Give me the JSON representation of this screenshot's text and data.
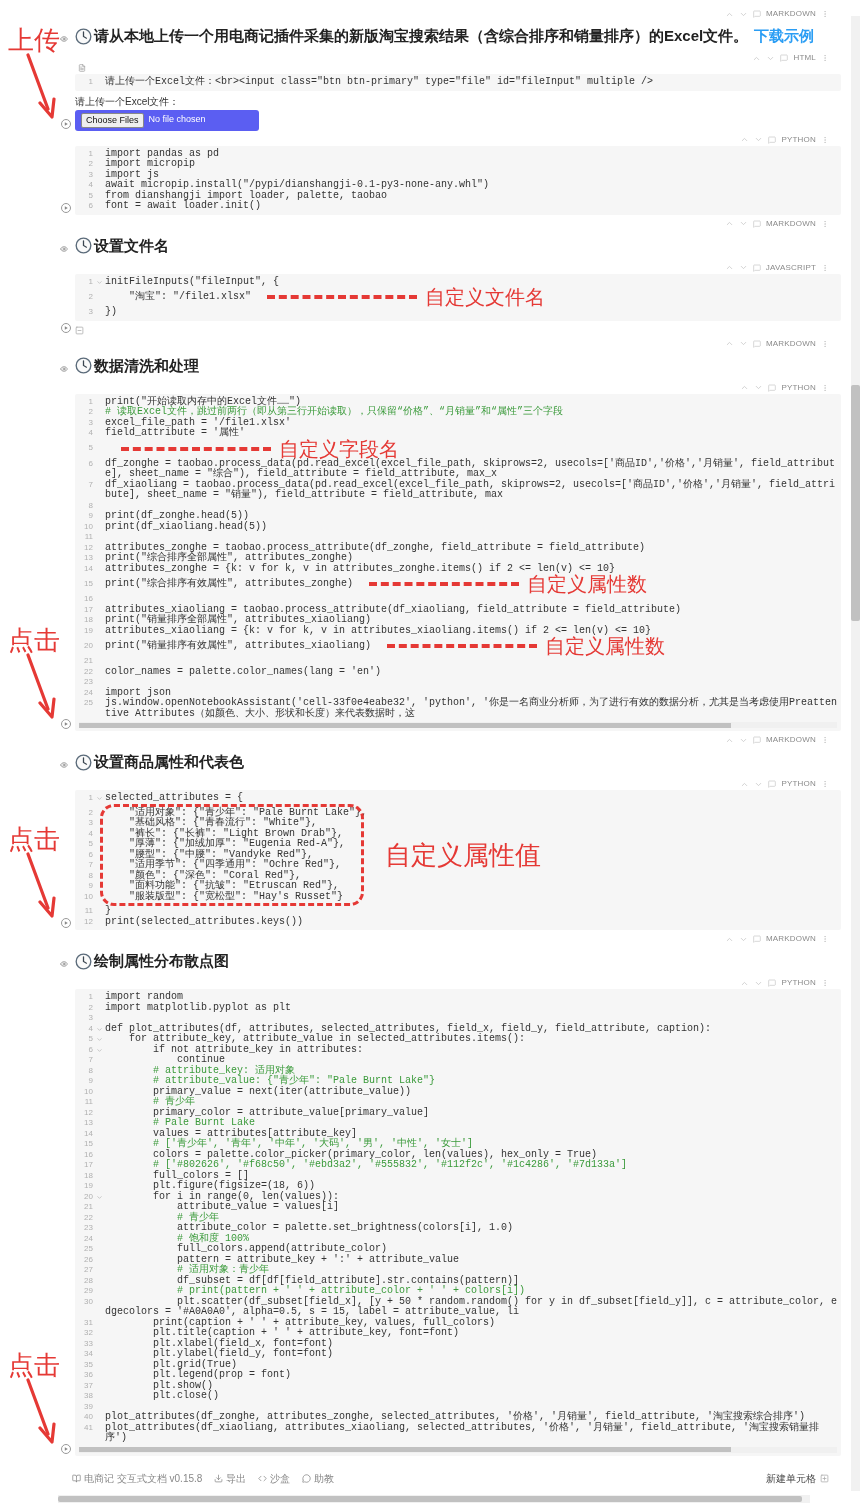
{
  "cells": [
    {
      "kind": "markdown",
      "lang": "MARKDOWN",
      "heading": "请从本地上传一个用电商记插件采集的新版淘宝搜索结果（含综合排序和销量排序）的Excel文件。",
      "link": "下载示例"
    },
    {
      "kind": "html",
      "lang": "HTML",
      "callout": "上传",
      "lines": [
        {
          "n": "1",
          "code": "请上传一个Excel文件：<br><input class=\"btn btn-primary\" type=\"file\" id=\"fileInput\" multiple />"
        }
      ],
      "output": {
        "label": "请上传一个Excel文件：",
        "button": "Choose Files",
        "status": "No file chosen"
      }
    },
    {
      "kind": "code",
      "lang": "PYTHON",
      "lines": [
        {
          "n": "1",
          "code": "import pandas as pd"
        },
        {
          "n": "2",
          "code": "import micropip"
        },
        {
          "n": "3",
          "code": "import js"
        },
        {
          "n": "4",
          "code": "await micropip.install(\"/pypi/dianshangji-0.1-py3-none-any.whl\")"
        },
        {
          "n": "5",
          "code": "from dianshangji import loader, palette, taobao"
        },
        {
          "n": "6",
          "code": "font = await loader.init()"
        }
      ]
    },
    {
      "kind": "markdown",
      "lang": "MARKDOWN",
      "heading": "设置文件名"
    },
    {
      "kind": "code",
      "lang": "JAVASCRIPT",
      "has_output": true,
      "lines": [
        {
          "n": "1",
          "fold": true,
          "code": "initFileInputs(\"fileInput\", {"
        },
        {
          "n": "2",
          "code": "    \"淘宝\": \"/file1.xlsx\"",
          "note": "自定义文件名"
        },
        {
          "n": "3",
          "code": "})"
        }
      ]
    },
    {
      "kind": "markdown",
      "lang": "MARKDOWN",
      "heading": "数据清洗和处理"
    },
    {
      "kind": "code",
      "lang": "PYTHON",
      "scrollable": true,
      "callout": "点击",
      "lines": [
        {
          "n": "1",
          "code": "print(\"开始读取内存中的Excel文件……\")"
        },
        {
          "n": "2",
          "kind": "comment",
          "code": "# 读取Excel文件，跳过前两行（即从第三行开始读取），只保留“价格”、“月销量”和“属性”三个字段"
        },
        {
          "n": "3",
          "code": "excel_file_path = '/file1.xlsx'"
        },
        {
          "n": "4",
          "code": "field_attribute = '属性'"
        },
        {
          "n": "5",
          "note": "自定义字段名"
        },
        {
          "n": "6",
          "code": "df_zonghe = taobao.process_data(pd.read_excel(excel_file_path, skiprows=2, usecols=['商品ID','价格','月销量', field_attribute], sheet_name = \"综合\"), field_attribute = field_attribute, max_x"
        },
        {
          "n": "7",
          "code": "df_xiaoliang = taobao.process_data(pd.read_excel(excel_file_path, skiprows=2, usecols=['商品ID','价格','月销量', field_attribute], sheet_name = \"销量\"), field_attribute = field_attribute, max"
        },
        {
          "n": "8"
        },
        {
          "n": "9",
          "code": "print(df_zonghe.head(5))"
        },
        {
          "n": "10",
          "code": "print(df_xiaoliang.head(5))"
        },
        {
          "n": "11"
        },
        {
          "n": "12",
          "code": "attributes_zonghe = taobao.process_attribute(df_zonghe, field_attribute = field_attribute)"
        },
        {
          "n": "13",
          "code": "print(\"综合排序全部属性\", attributes_zonghe)"
        },
        {
          "n": "14",
          "code": "attributes_zonghe = {k: v for k, v in attributes_zonghe.items() if 2 <= len(v) <= 10}"
        },
        {
          "n": "15",
          "code": "print(\"综合排序有效属性\", attributes_zonghe)",
          "note": "自定义属性数"
        },
        {
          "n": "16"
        },
        {
          "n": "17",
          "code": "attributes_xiaoliang = taobao.process_attribute(df_xiaoliang, field_attribute = field_attribute)"
        },
        {
          "n": "18",
          "code": "print(\"销量排序全部属性\", attributes_xiaoliang)"
        },
        {
          "n": "19",
          "code": "attributes_xiaoliang = {k: v for k, v in attributes_xiaoliang.items() if 2 <= len(v) <= 10}"
        },
        {
          "n": "20",
          "code": "print(\"销量排序有效属性\", attributes_xiaoliang)",
          "note": "自定义属性数"
        },
        {
          "n": "21"
        },
        {
          "n": "22",
          "code": "color_names = palette.color_names(lang = 'en')"
        },
        {
          "n": "23"
        },
        {
          "n": "24",
          "code": "import json"
        },
        {
          "n": "25",
          "code": "js.window.openNotebookAssistant('cell-33f0e4eabe32', 'python', '你是一名商业分析师，为了进行有效的数据分析，尤其是当考虑使用Preattentive Attributes（如颜色、大小、形状和长度）来代表数据时，这"
        }
      ]
    },
    {
      "kind": "markdown",
      "lang": "MARKDOWN",
      "heading": "设置商品属性和代表色"
    },
    {
      "kind": "code",
      "lang": "PYTHON",
      "callout": "点击",
      "frame_note": "自定义属性值",
      "lines": [
        {
          "n": "1",
          "fold": true,
          "code": "selected_attributes = {"
        },
        {
          "n": "2",
          "framed": true,
          "code": "    \"适用对象\": {\"青少年\": \"Pale Burnt Lake\"},"
        },
        {
          "n": "3",
          "framed": true,
          "code": "    \"基础风格\": {\"青春流行\": \"White\"},"
        },
        {
          "n": "4",
          "framed": true,
          "code": "    \"裤长\": {\"长裤\": \"Light Brown Drab\"},"
        },
        {
          "n": "5",
          "framed": true,
          "code": "    \"厚薄\": {\"加绒加厚\": \"Eugenia Red-A\"},"
        },
        {
          "n": "6",
          "framed": true,
          "code": "    \"腰型\": {\"中腰\": \"Vandyke Red\"},"
        },
        {
          "n": "7",
          "framed": true,
          "code": "    \"适用季节\": {\"四季通用\": \"Ochre Red\"},"
        },
        {
          "n": "8",
          "framed": true,
          "code": "    \"颜色\": {\"深色\": \"Coral Red\"},"
        },
        {
          "n": "9",
          "framed": true,
          "code": "    \"面料功能\": {\"抗皱\": \"Etruscan Red\"},"
        },
        {
          "n": "10",
          "framed": true,
          "code": "    \"服装版型\": {\"宽松型\": \"Hay's Russet\"}"
        },
        {
          "n": "11",
          "code": "}"
        },
        {
          "n": "12",
          "code": "print(selected_attributes.keys())"
        }
      ]
    },
    {
      "kind": "markdown",
      "lang": "MARKDOWN",
      "heading": "绘制属性分布散点图"
    },
    {
      "kind": "code",
      "lang": "PYTHON",
      "scrollable": true,
      "callout": "点击",
      "lines": [
        {
          "n": "1",
          "code": "import random"
        },
        {
          "n": "2",
          "code": "import matplotlib.pyplot as plt"
        },
        {
          "n": "3"
        },
        {
          "n": "4",
          "fold": true,
          "code": "def plot_attributes(df, attributes, selected_attributes, field_x, field_y, field_attribute, caption):"
        },
        {
          "n": "5",
          "fold": true,
          "code": "    for attribute_key, attribute_value in selected_attributes.items():"
        },
        {
          "n": "6",
          "fold": true,
          "code": "        if not attribute_key in attributes:"
        },
        {
          "n": "7",
          "code": "            continue"
        },
        {
          "n": "8",
          "kind": "comment",
          "code": "        # attribute_key: 适用对象"
        },
        {
          "n": "9",
          "kind": "comment",
          "code": "        # attribute_value: {\"青少年\": \"Pale Burnt Lake\"}"
        },
        {
          "n": "10",
          "code": "        primary_value = next(iter(attribute_value))"
        },
        {
          "n": "11",
          "kind": "comment",
          "code": "        # 青少年"
        },
        {
          "n": "12",
          "code": "        primary_color = attribute_value[primary_value]"
        },
        {
          "n": "13",
          "kind": "comment",
          "code": "        # Pale Burnt Lake"
        },
        {
          "n": "14",
          "code": "        values = attributes[attribute_key]"
        },
        {
          "n": "15",
          "kind": "comment",
          "code": "        # ['青少年', '青年', '中年', '大码', '男', '中性', '女士']"
        },
        {
          "n": "16",
          "code": "        colors = palette.color_picker(primary_color, len(values), hex_only = True)"
        },
        {
          "n": "17",
          "kind": "comment",
          "code": "        # ['#802626', '#f68c50', '#ebd3a2', '#555832', '#112f2c', '#1c4286', '#7d133a']"
        },
        {
          "n": "18",
          "code": "        full_colors = []"
        },
        {
          "n": "19",
          "code": "        plt.figure(figsize=(18, 6))"
        },
        {
          "n": "20",
          "fold": true,
          "code": "        for i in range(0, len(values)):"
        },
        {
          "n": "21",
          "code": "            attribute_value = values[i]"
        },
        {
          "n": "22",
          "kind": "comment",
          "code": "            # 青少年"
        },
        {
          "n": "23",
          "code": "            attribute_color = palette.set_brightness(colors[i], 1.0)"
        },
        {
          "n": "24",
          "kind": "comment",
          "code": "            # 饱和度 100%"
        },
        {
          "n": "25",
          "code": "            full_colors.append(attribute_color)"
        },
        {
          "n": "26",
          "code": "            pattern = attribute_key + ':' + attribute_value"
        },
        {
          "n": "27",
          "kind": "comment",
          "code": "            # 适用对象：青少年"
        },
        {
          "n": "28",
          "code": "            df_subset = df[df[field_attribute].str.contains(pattern)]"
        },
        {
          "n": "29",
          "kind": "comment",
          "code": "            # print(pattern + ' ' + attribute_color + ' ' + colors[i])"
        },
        {
          "n": "30",
          "code": "            plt.scatter(df_subset[field_x], [y + 50 * random.random() for y in df_subset[field_y]], c = attribute_color, edgecolors = '#A0A0A0', alpha=0.5, s = 15, label = attribute_value, li"
        },
        {
          "n": "31",
          "code": "        print(caption + ' ' + attribute_key, values, full_colors)"
        },
        {
          "n": "32",
          "code": "        plt.title(caption + ' ' + attribute_key, font=font)"
        },
        {
          "n": "33",
          "code": "        plt.xlabel(field_x, font=font)"
        },
        {
          "n": "34",
          "code": "        plt.ylabel(field_y, font=font)"
        },
        {
          "n": "35",
          "code": "        plt.grid(True)"
        },
        {
          "n": "36",
          "code": "        plt.legend(prop = font)"
        },
        {
          "n": "37",
          "code": "        plt.show()"
        },
        {
          "n": "38",
          "code": "        plt.close()"
        },
        {
          "n": "39"
        },
        {
          "n": "40",
          "code": "plot_attributes(df_zonghe, attributes_zonghe, selected_attributes, '价格', '月销量', field_attribute, '淘宝搜索综合排序')"
        },
        {
          "n": "41",
          "code": "plot_attributes(df_xiaoliang, attributes_xiaoliang, selected_attributes, '价格', '月销量', field_attribute, '淘宝搜索销量排序')"
        }
      ]
    }
  ],
  "footer": {
    "brand": "电商记 交互式文档 v0.15.8",
    "actions": [
      "导出",
      "沙盒",
      "助教"
    ],
    "new_cell": "新建单元格"
  }
}
